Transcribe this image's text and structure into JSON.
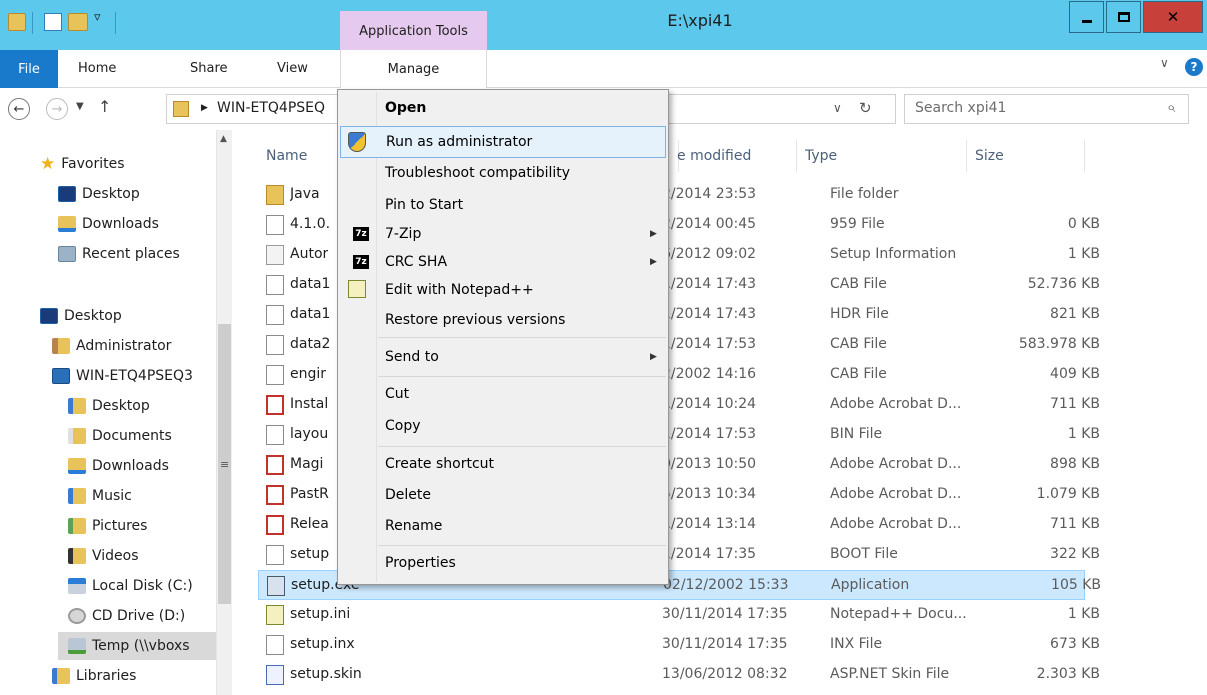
{
  "window": {
    "title": "E:\\xpi41",
    "context_tab": "Application Tools"
  },
  "ribbon": {
    "file": "File",
    "home": "Home",
    "share": "Share",
    "view": "View",
    "manage": "Manage"
  },
  "address": {
    "path": "WIN-ETQ4PSEQ",
    "search_placeholder": "Search xpi41"
  },
  "nav": {
    "favorites": "Favorites",
    "fav_desktop": "Desktop",
    "fav_downloads": "Downloads",
    "fav_recent": "Recent places",
    "desktop": "Desktop",
    "administrator": "Administrator",
    "computer": "WIN-ETQ4PSEQ3",
    "pc_desktop": "Desktop",
    "pc_documents": "Documents",
    "pc_downloads": "Downloads",
    "pc_music": "Music",
    "pc_pictures": "Pictures",
    "pc_videos": "Videos",
    "local_disk": "Local Disk (C:)",
    "cd_drive": "CD Drive (D:)",
    "temp": "Temp (\\\\vboxs",
    "libraries": "Libraries"
  },
  "columns": {
    "name": "Name",
    "modified": "e modified",
    "type": "Type",
    "size": "Size"
  },
  "files": [
    {
      "name": "Java",
      "modified": "2/2014 23:53",
      "type": "File folder",
      "size": ""
    },
    {
      "name": "4.1.0.",
      "modified": "2/2014 00:45",
      "type": "959 File",
      "size": "0 KB"
    },
    {
      "name": "Autor",
      "modified": "6/2012 09:02",
      "type": "Setup Information",
      "size": "1 KB"
    },
    {
      "name": "data1",
      "modified": "1/2014 17:43",
      "type": "CAB File",
      "size": "52.736 KB"
    },
    {
      "name": "data1",
      "modified": "1/2014 17:43",
      "type": "HDR File",
      "size": "821 KB"
    },
    {
      "name": "data2",
      "modified": "1/2014 17:53",
      "type": "CAB File",
      "size": "583.978 KB"
    },
    {
      "name": "engir",
      "modified": "2/2002 14:16",
      "type": "CAB File",
      "size": "409 KB"
    },
    {
      "name": "Instal",
      "modified": "1/2014 10:24",
      "type": "Adobe Acrobat D...",
      "size": "711 KB"
    },
    {
      "name": "layou",
      "modified": "1/2014 17:53",
      "type": "BIN File",
      "size": "1 KB"
    },
    {
      "name": "Magi",
      "modified": "0/2013 10:50",
      "type": "Adobe Acrobat D...",
      "size": "898 KB"
    },
    {
      "name": "PastR",
      "modified": "5/2013 10:34",
      "type": "Adobe Acrobat D...",
      "size": "1.079 KB"
    },
    {
      "name": "Relea",
      "modified": "1/2014 13:14",
      "type": "Adobe Acrobat D...",
      "size": "711 KB"
    },
    {
      "name": "setup",
      "modified": "1/2014 17:35",
      "type": "BOOT File",
      "size": "322 KB"
    },
    {
      "name": "setup.exe",
      "modified": "02/12/2002 15:33",
      "type": "Application",
      "size": "105 KB"
    },
    {
      "name": "setup.ini",
      "modified": "30/11/2014 17:35",
      "type": "Notepad++ Docu...",
      "size": "1 KB"
    },
    {
      "name": "setup.inx",
      "modified": "30/11/2014 17:35",
      "type": "INX File",
      "size": "673 KB"
    },
    {
      "name": "setup.skin",
      "modified": "13/06/2012 08:32",
      "type": "ASP.NET Skin File",
      "size": "2.303 KB"
    }
  ],
  "menu": {
    "open": "Open",
    "run_admin": "Run as administrator",
    "troubleshoot": "Troubleshoot compatibility",
    "pin": "Pin to Start",
    "zip": "7-Zip",
    "crc": "CRC SHA",
    "notepad": "Edit with Notepad++",
    "restore": "Restore previous versions",
    "send_to": "Send to",
    "cut": "Cut",
    "copy": "Copy",
    "shortcut": "Create shortcut",
    "delete": "Delete",
    "rename": "Rename",
    "properties": "Properties",
    "zip_badge": "7z"
  }
}
